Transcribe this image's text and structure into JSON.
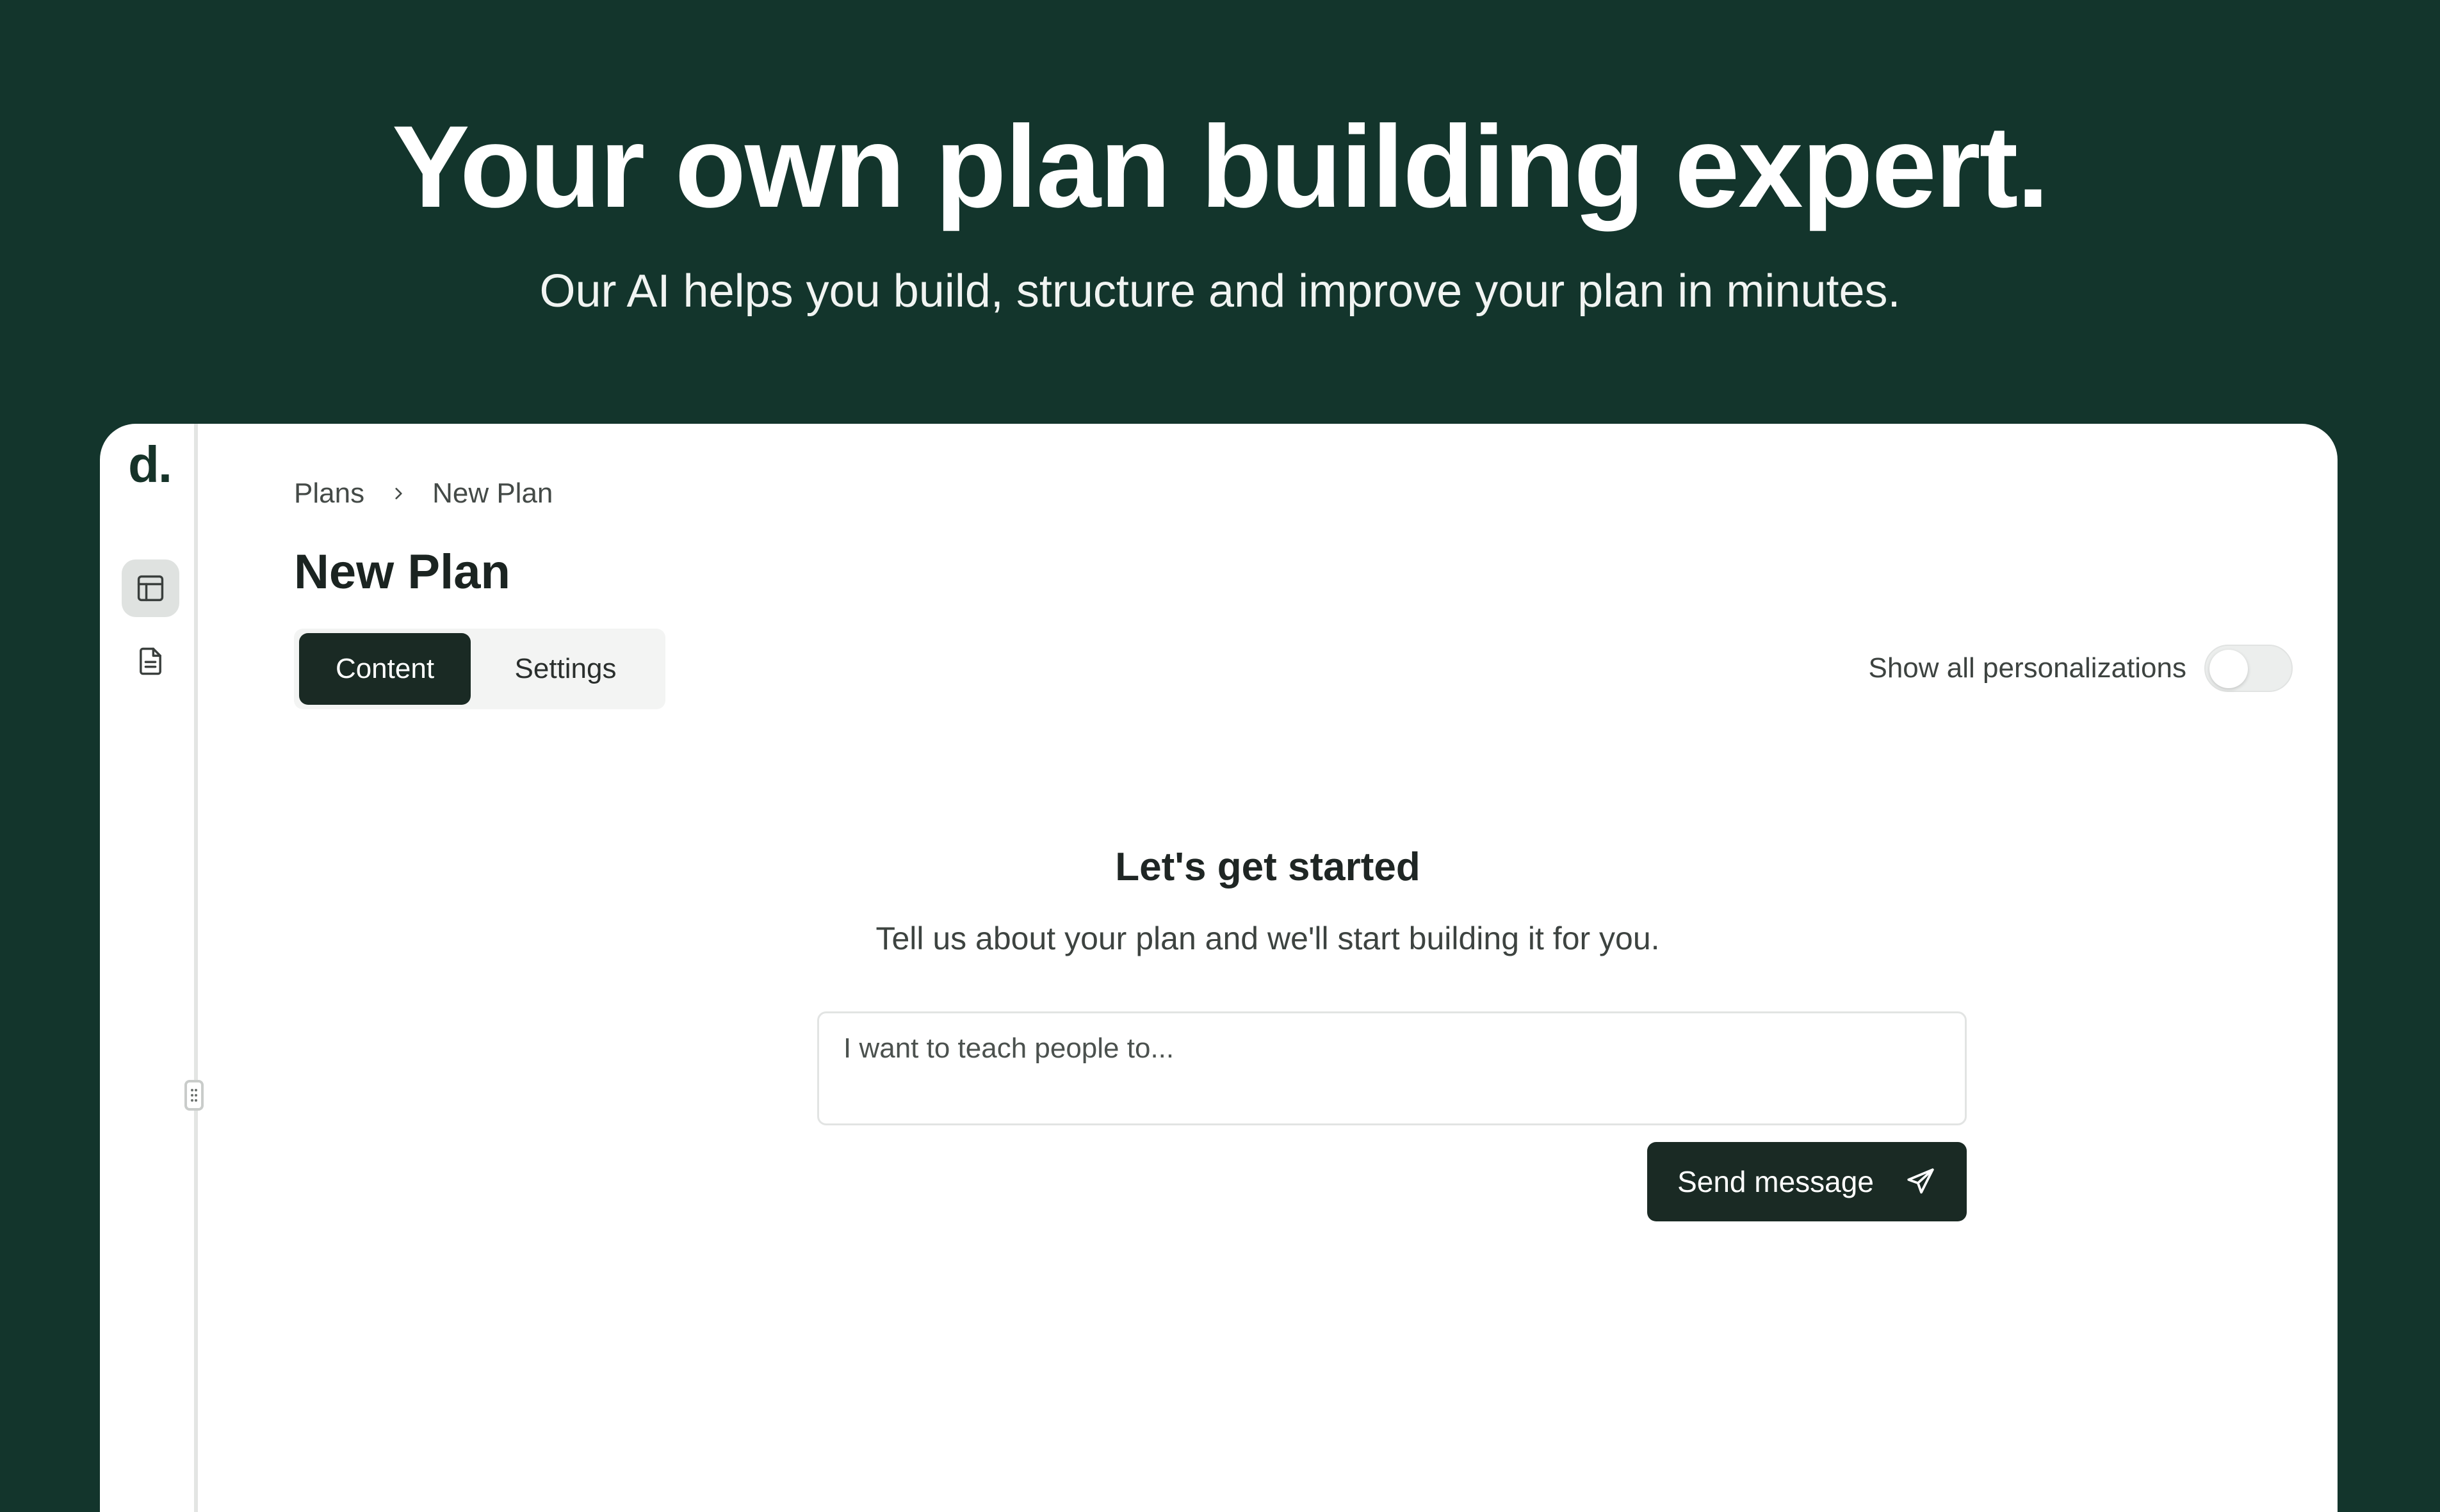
{
  "hero": {
    "title": "Your own plan building expert.",
    "subtitle": "Our AI helps you build, structure and improve your plan in minutes."
  },
  "app": {
    "logo": "d.",
    "sidebar": {
      "items": [
        {
          "icon": "layout-icon",
          "active": true
        },
        {
          "icon": "document-icon",
          "active": false
        }
      ]
    },
    "breadcrumb": {
      "items": [
        "Plans",
        "New Plan"
      ]
    },
    "page_title": "New Plan",
    "tabs": [
      {
        "label": "Content",
        "active": true
      },
      {
        "label": "Settings",
        "active": false
      }
    ],
    "personalizations": {
      "label": "Show all personalizations",
      "enabled": false
    },
    "start": {
      "title": "Let's get started",
      "description": "Tell us about your plan and we'll start building it for you.",
      "input_placeholder": "I want to teach people to...",
      "input_value": "",
      "send_label": "Send message"
    }
  },
  "colors": {
    "background": "#13352c",
    "accent_dark": "#1a2a24",
    "surface": "#ffffff"
  }
}
